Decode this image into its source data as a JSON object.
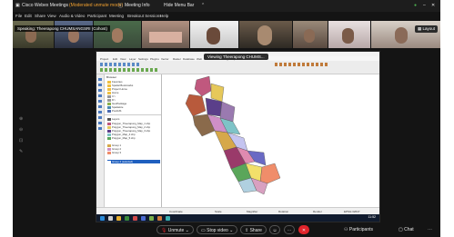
{
  "window": {
    "title": "Cisco Webex Meetings",
    "title_suffix": "(Moderated unmute mode)",
    "meeting_info": "Meeting Info",
    "hide_menu_bar": "Hide Menu Bar"
  },
  "menu": [
    "File",
    "Edit",
    "Share",
    "View",
    "Audio & Video",
    "Participant",
    "Meeting",
    "Breakout Sessions",
    "Help"
  ],
  "speaking": "Speaking: Theerapong CHUMSANGSRI (Cohost)",
  "layout_button": "Layout",
  "share": {
    "viewing_label": "Viewing Theerapong CHUMS...",
    "layers_title": "Browser",
    "layers": [
      "Favorites",
      "Spatial Bookmarks",
      "Project Home",
      "Home",
      "C:\\",
      "D:\\",
      "GeoPackage",
      "SpatiaLite",
      "PostGIS",
      "Layers",
      "Polygon_Theerapong_Map_1.shp",
      "Polygon_Theerapong_Map_2.shp",
      "Polygon_Theerapong_Map_3.shp",
      "Polygon_Map_4.shp",
      "Polygon_Map_5.shp",
      "Group 1",
      "Group 2",
      "Group 3",
      "Group 4 (selected)"
    ],
    "qgis_menu": [
      "Project",
      "Edit",
      "View",
      "Layer",
      "Settings",
      "Plugins",
      "Vector",
      "Raster",
      "Database",
      "Web",
      "Mesh",
      "Processing",
      "Help"
    ],
    "map_colors": [
      "#c0587e",
      "#e6c85a",
      "#5b3f8a",
      "#8a6a4b",
      "#b85a3c",
      "#cf8fc7",
      "#7ec3c7",
      "#d6a84a",
      "#9a3a6a",
      "#5aa65a",
      "#f08d6a",
      "#c4c4f0",
      "#f2e06a",
      "#6a6ac4"
    ]
  },
  "status_bar": {
    "coordinate": "Coordinate",
    "scale": "Scale",
    "magnifier": "Magnifier",
    "rotation": "Rotation",
    "render": "Render",
    "epsg": "EPSG:32647"
  },
  "taskbar_time": "11:52",
  "controls": {
    "unmute": "Unmute",
    "stop_video": "Stop video",
    "share": "Share",
    "participants": "Participants",
    "chat": "Chat"
  },
  "colors": {
    "accent_blue": "#1a73e8",
    "leave_red": "#e0242b",
    "webex_title_orange": "#f0a030"
  }
}
